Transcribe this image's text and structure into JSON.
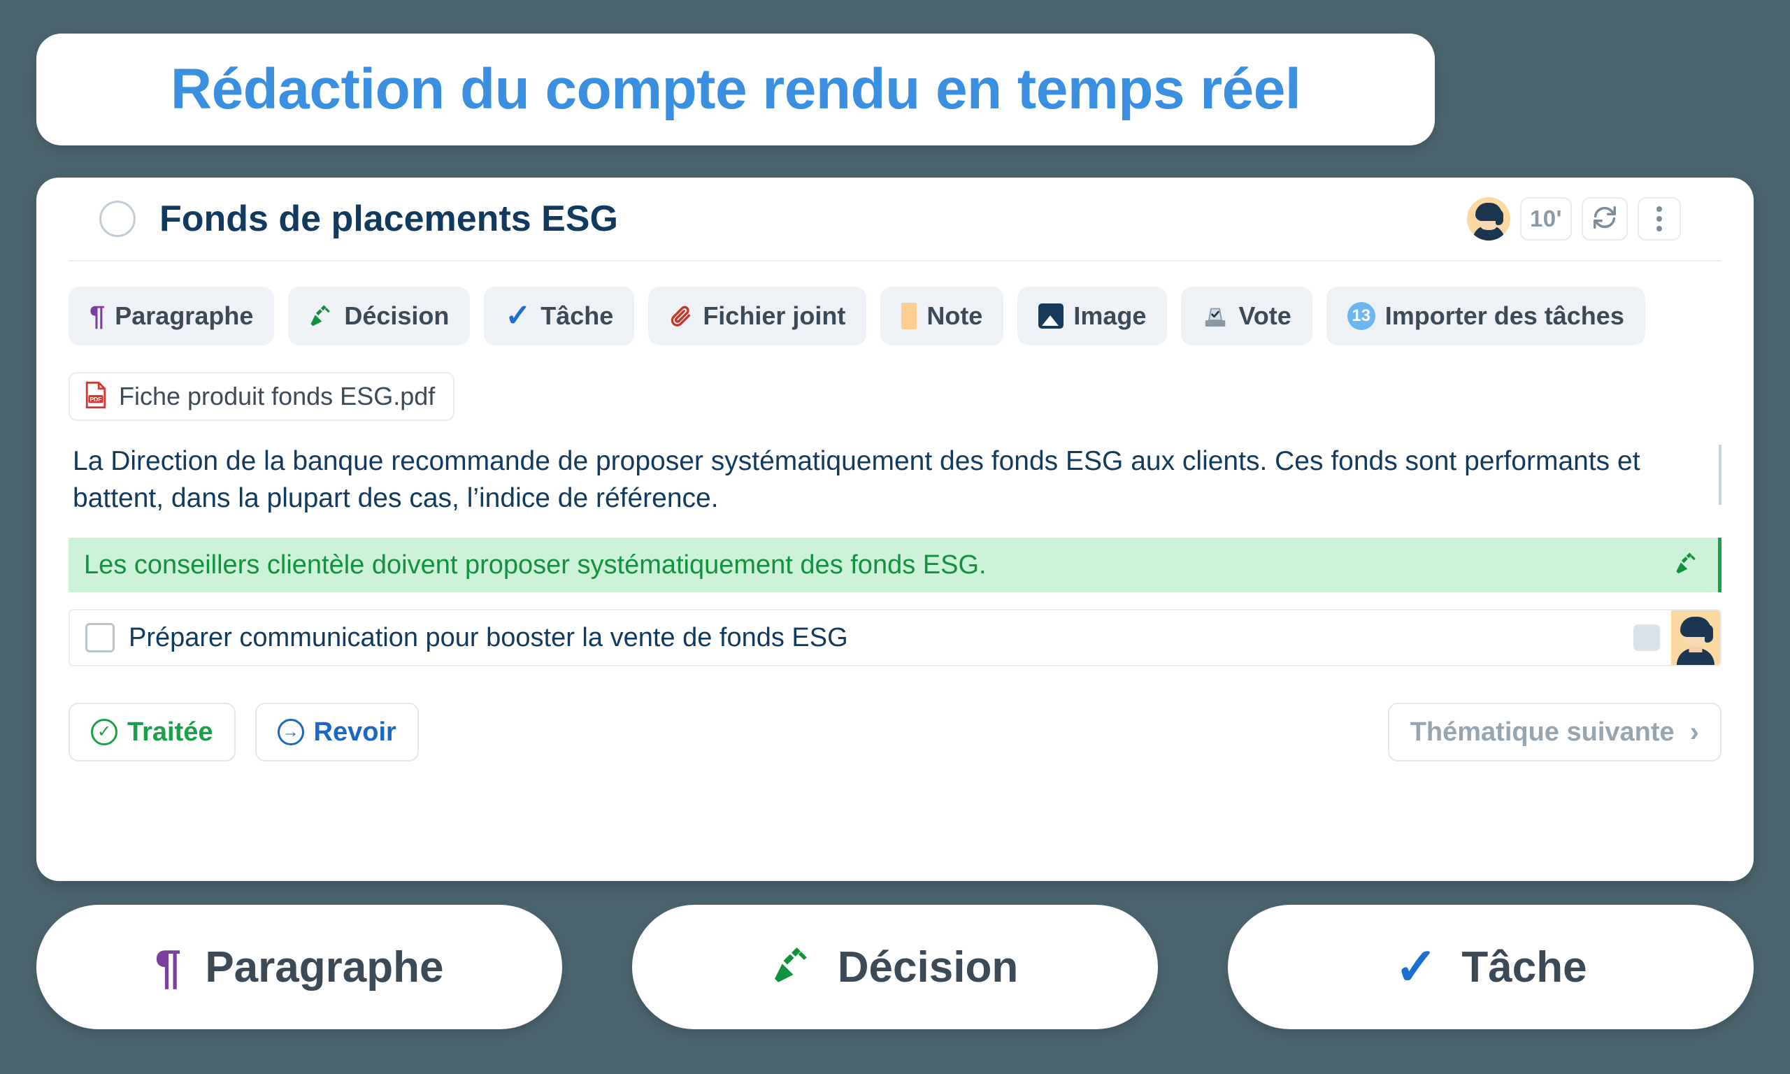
{
  "banner": {
    "title": "Rédaction du compte rendu en temps réel",
    "accent_color": "#3b8fe0"
  },
  "page": {
    "background_color": "#4c6671"
  },
  "card": {
    "header": {
      "title": "Fonds de placements ESG",
      "status_circle": "empty-circle",
      "avatar_name": "user-avatar",
      "timer_label": "10'",
      "refresh_icon": "refresh-icon",
      "more_icon": "more-vertical-icon"
    },
    "toolbar": [
      {
        "label": "Paragraphe",
        "icon": "pilcrow-icon",
        "icon_color": "#7b3f9d"
      },
      {
        "label": "Décision",
        "icon": "gavel-icon",
        "icon_color": "#12923f"
      },
      {
        "label": "Tâche",
        "icon": "check-icon",
        "icon_color": "#1c6fd0"
      },
      {
        "label": "Fichier joint",
        "icon": "paperclip-icon",
        "icon_color": "#c0392b"
      },
      {
        "label": "Note",
        "icon": "note-icon",
        "icon_color": "#fbce93"
      },
      {
        "label": "Image",
        "icon": "image-icon",
        "icon_color": "#153a5b"
      },
      {
        "label": "Vote",
        "icon": "vote-ballot-icon",
        "icon_color": "#6b7c8c"
      },
      {
        "label": "Importer des tâches",
        "icon": "badge-count-icon",
        "badge": "13",
        "icon_color": "#6cb6f0"
      }
    ],
    "content": {
      "attachment": {
        "filename": "Fiche produit fonds ESG.pdf",
        "icon": "pdf-file-icon"
      },
      "paragraph": "La Direction de la banque recommande de proposer systématiquement des fonds ESG aux clients. Ces fonds sont performants et battent, dans la plupart des cas, l’indice de référence.",
      "decision": {
        "text": "Les conseillers clientèle doivent proposer systématiquement des fonds ESG.",
        "icon": "gavel-icon",
        "background_color": "#ccf2d7",
        "text_color": "#12923f",
        "accent_color": "#1aa04a"
      },
      "task": {
        "text": "Préparer communication pour booster la vente de fonds ESG",
        "checked": false,
        "assignee_avatar": "task-assignee-avatar"
      }
    },
    "footer": {
      "processed_label": "Traitée",
      "processed_icon": "check-circle-icon",
      "processed_color": "#19a049",
      "review_label": "Revoir",
      "review_icon": "arrow-right-circle-icon",
      "review_color": "#1a67c4",
      "next_label": "Thématique suivante",
      "next_icon": "chevron-right-icon",
      "next_color": "#97a5b1"
    }
  },
  "pills": [
    {
      "label": "Paragraphe",
      "icon": "pilcrow-icon",
      "icon_color": "#7b3f9d"
    },
    {
      "label": "Décision",
      "icon": "gavel-icon",
      "icon_color": "#12923f"
    },
    {
      "label": "Tâche",
      "icon": "check-icon",
      "icon_color": "#1c6fd0"
    }
  ]
}
